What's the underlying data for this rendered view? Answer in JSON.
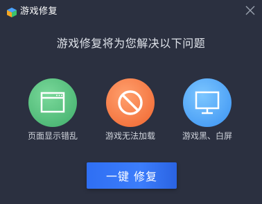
{
  "window": {
    "title": "游戏修复",
    "logo_icon": "game-cube-icon",
    "close_icon": "close-icon"
  },
  "headline": "游戏修复将为您解决以下问题",
  "issues": [
    {
      "label": "页面显示错乱",
      "icon": "browser-window-icon",
      "color": "#4fbf7a"
    },
    {
      "label": "游戏无法加载",
      "icon": "prohibited-icon",
      "color": "#f47a42"
    },
    {
      "label": "游戏黑、白屏",
      "icon": "monitor-icon",
      "color": "#4ea4f7"
    }
  ],
  "fix_button": {
    "label": "一键 修复",
    "color": "#3373f5"
  },
  "colors": {
    "background": "#2b3040"
  }
}
